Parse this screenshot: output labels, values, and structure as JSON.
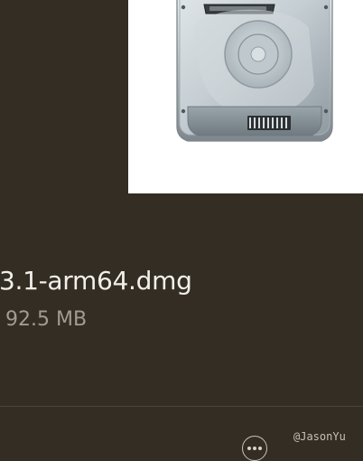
{
  "file": {
    "name": "3.1-arm64.dmg",
    "size": "92.5 MB"
  },
  "preview": {
    "icon": "hard-drive-icon"
  },
  "toolbar": {
    "more_icon": "more-icon"
  },
  "watermark": "@JasonYu",
  "colors": {
    "background": "#332d24",
    "preview_background": "#ffffff",
    "title": "#f2efea",
    "subtitle": "#a29b91"
  }
}
